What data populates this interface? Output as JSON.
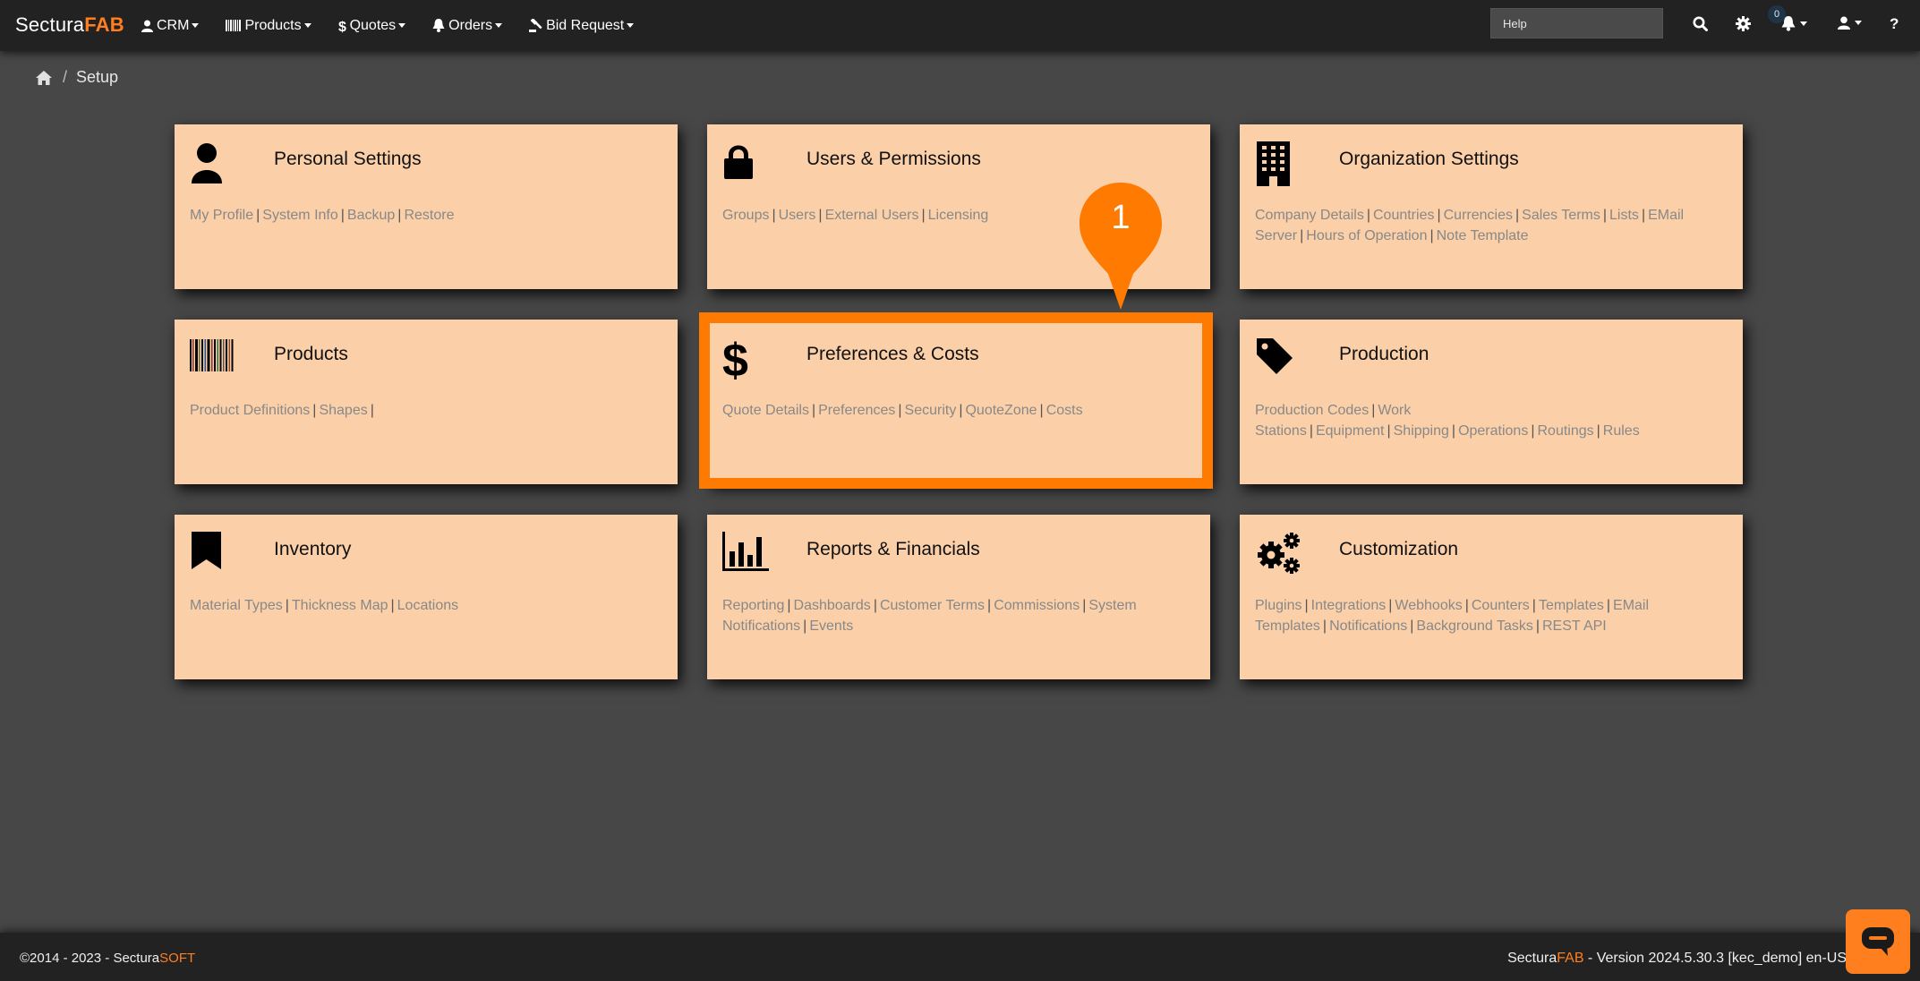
{
  "brand": {
    "prefix": "Sectura",
    "suffix": "FAB"
  },
  "nav": [
    {
      "label": "CRM",
      "icon": "user-icon"
    },
    {
      "label": "Products",
      "icon": "barcode-icon"
    },
    {
      "label": "Quotes",
      "icon": "dollar-icon"
    },
    {
      "label": "Orders",
      "icon": "bell-icon"
    },
    {
      "label": "Bid Request",
      "icon": "gavel-icon"
    }
  ],
  "search": {
    "placeholder": "Help"
  },
  "notifications": {
    "count": "0"
  },
  "breadcrumb": {
    "current": "Setup"
  },
  "cards": [
    {
      "title": "Personal Settings",
      "icon": "user-icon",
      "links": [
        "My Profile",
        "System Info",
        "Backup",
        "Restore"
      ]
    },
    {
      "title": "Users & Permissions",
      "icon": "lock-icon",
      "links": [
        "Groups",
        "Users",
        "External Users",
        "Licensing"
      ]
    },
    {
      "title": "Organization Settings",
      "icon": "building-icon",
      "links": [
        "Company Details",
        "Countries",
        "Currencies",
        "Sales Terms",
        "Lists",
        "EMail Server",
        "Hours of Operation",
        "Note Template"
      ]
    },
    {
      "title": "Products",
      "icon": "barcode-icon",
      "links": [
        "Product Definitions",
        "Shapes"
      ]
    },
    {
      "title": "Preferences & Costs",
      "icon": "dollar-icon",
      "links": [
        "Quote Details",
        "Preferences",
        "Security",
        "QuoteZone",
        "Costs"
      ]
    },
    {
      "title": "Production",
      "icon": "tag-icon",
      "links": [
        "Production Codes",
        "Work Stations",
        "Equipment",
        "Shipping",
        "Operations",
        "Routings",
        "Rules"
      ]
    },
    {
      "title": "Inventory",
      "icon": "bookmark-icon",
      "links": [
        "Material Types",
        "Thickness Map",
        "Locations"
      ]
    },
    {
      "title": "Reports & Financials",
      "icon": "bar-chart-icon",
      "links": [
        "Reporting",
        "Dashboards",
        "Customer Terms",
        "Commissions",
        "System Notifications",
        "Events"
      ]
    },
    {
      "title": "Customization",
      "icon": "cogs-icon",
      "links": [
        "Plugins",
        "Integrations",
        "Webhooks",
        "Counters",
        "Templates",
        "EMail Templates",
        "Notifications",
        "Background Tasks",
        "REST API"
      ]
    }
  ],
  "callout": {
    "number": "1"
  },
  "footer": {
    "copyright_prefix": "©2014 - 2023 - Sectura",
    "copyright_suffix": "SOFT",
    "version_brand_prefix": "Sectura",
    "version_brand_suffix": "FAB",
    "version_text": " - Version 2024.5.30.3 [kec_demo] en-US"
  },
  "colors": {
    "accent": "#ff7f1f",
    "card_bg": "#fbd0a8",
    "navbar": "#222222",
    "page_bg": "#474747"
  }
}
